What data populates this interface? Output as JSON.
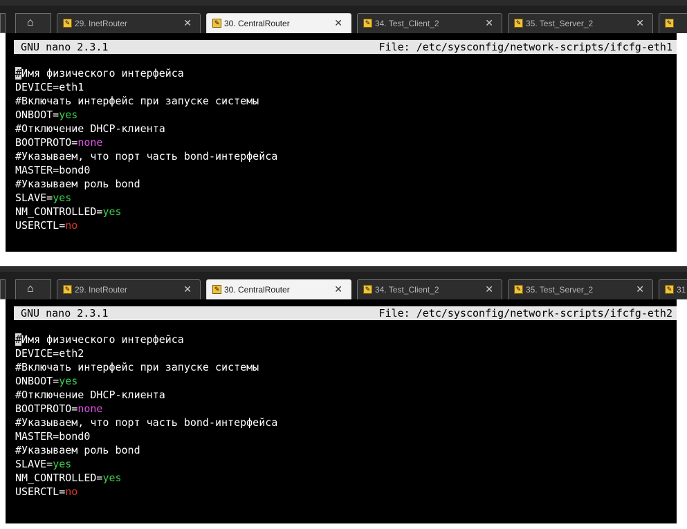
{
  "colors": {
    "yes": "#3ad24d",
    "none": "#e152e8",
    "no": "#e0382f",
    "terminal_bg": "#000000",
    "titlebar_bg": "#e6e6e6"
  },
  "panels": [
    {
      "tabs": [
        {
          "label": "29. InetRouter",
          "close": "✕",
          "icon": "wrench-icon"
        },
        {
          "label": "30. CentralRouter",
          "close": "✕",
          "icon": "wrench-icon"
        },
        {
          "label": "34. Test_Client_2",
          "close": "✕",
          "icon": "wrench-icon"
        },
        {
          "label": "35. Test_Server_2",
          "close": "✕",
          "icon": "wrench-icon"
        },
        {
          "label": "",
          "close": "",
          "icon": "wrench-icon"
        }
      ],
      "nano_version": "GNU nano 2.3.1",
      "file_label": "File: /etc/sysconfig/network-scripts/ifcfg-eth1",
      "lines": [
        {
          "text": "#Имя физического интерфейса"
        },
        {
          "key": "DEVICE=",
          "value": "eth1",
          "style": ""
        },
        {
          "text": "#Включать интерфейс при запуске системы"
        },
        {
          "key": "ONBOOT=",
          "value": "yes",
          "style": "v-yes"
        },
        {
          "text": "#Отключение DHCP-клиента"
        },
        {
          "key": "BOOTPROTO=",
          "value": "none",
          "style": "v-none"
        },
        {
          "text": "#Указываем, что порт часть bond-интерфейса"
        },
        {
          "key": "MASTER=",
          "value": "bond0",
          "style": ""
        },
        {
          "text": "#Указываем роль bond"
        },
        {
          "key": "SLAVE=",
          "value": "yes",
          "style": "v-yes"
        },
        {
          "key": "NM_CONTROLLED=",
          "value": "yes",
          "style": "v-yes"
        },
        {
          "key": "USERCTL=",
          "value": "no",
          "style": "v-no"
        }
      ]
    },
    {
      "tabs": [
        {
          "label": "29. InetRouter",
          "close": "✕",
          "icon": "wrench-icon"
        },
        {
          "label": "30. CentralRouter",
          "close": "✕",
          "icon": "wrench-icon"
        },
        {
          "label": "34. Test_Client_2",
          "close": "✕",
          "icon": "wrench-icon"
        },
        {
          "label": "35. Test_Server_2",
          "close": "✕",
          "icon": "wrench-icon"
        },
        {
          "label": "31",
          "close": "",
          "icon": "wrench-icon"
        }
      ],
      "nano_version": "GNU nano 2.3.1",
      "file_label": "File: /etc/sysconfig/network-scripts/ifcfg-eth2",
      "lines": [
        {
          "text": "#Имя физического интерфейса"
        },
        {
          "key": "DEVICE=",
          "value": "eth2",
          "style": ""
        },
        {
          "text": "#Включать интерфейс при запуске системы"
        },
        {
          "key": "ONBOOT=",
          "value": "yes",
          "style": "v-yes"
        },
        {
          "text": "#Отключение DHCP-клиента"
        },
        {
          "key": "BOOTPROTO=",
          "value": "none",
          "style": "v-none"
        },
        {
          "text": "#Указываем, что порт часть bond-интерфейса"
        },
        {
          "key": "MASTER=",
          "value": "bond0",
          "style": ""
        },
        {
          "text": "#Указываем роль bond"
        },
        {
          "key": "SLAVE=",
          "value": "yes",
          "style": "v-yes"
        },
        {
          "key": "NM_CONTROLLED=",
          "value": "yes",
          "style": "v-yes"
        },
        {
          "key": "USERCTL=",
          "value": "no",
          "style": "v-no"
        }
      ]
    }
  ]
}
